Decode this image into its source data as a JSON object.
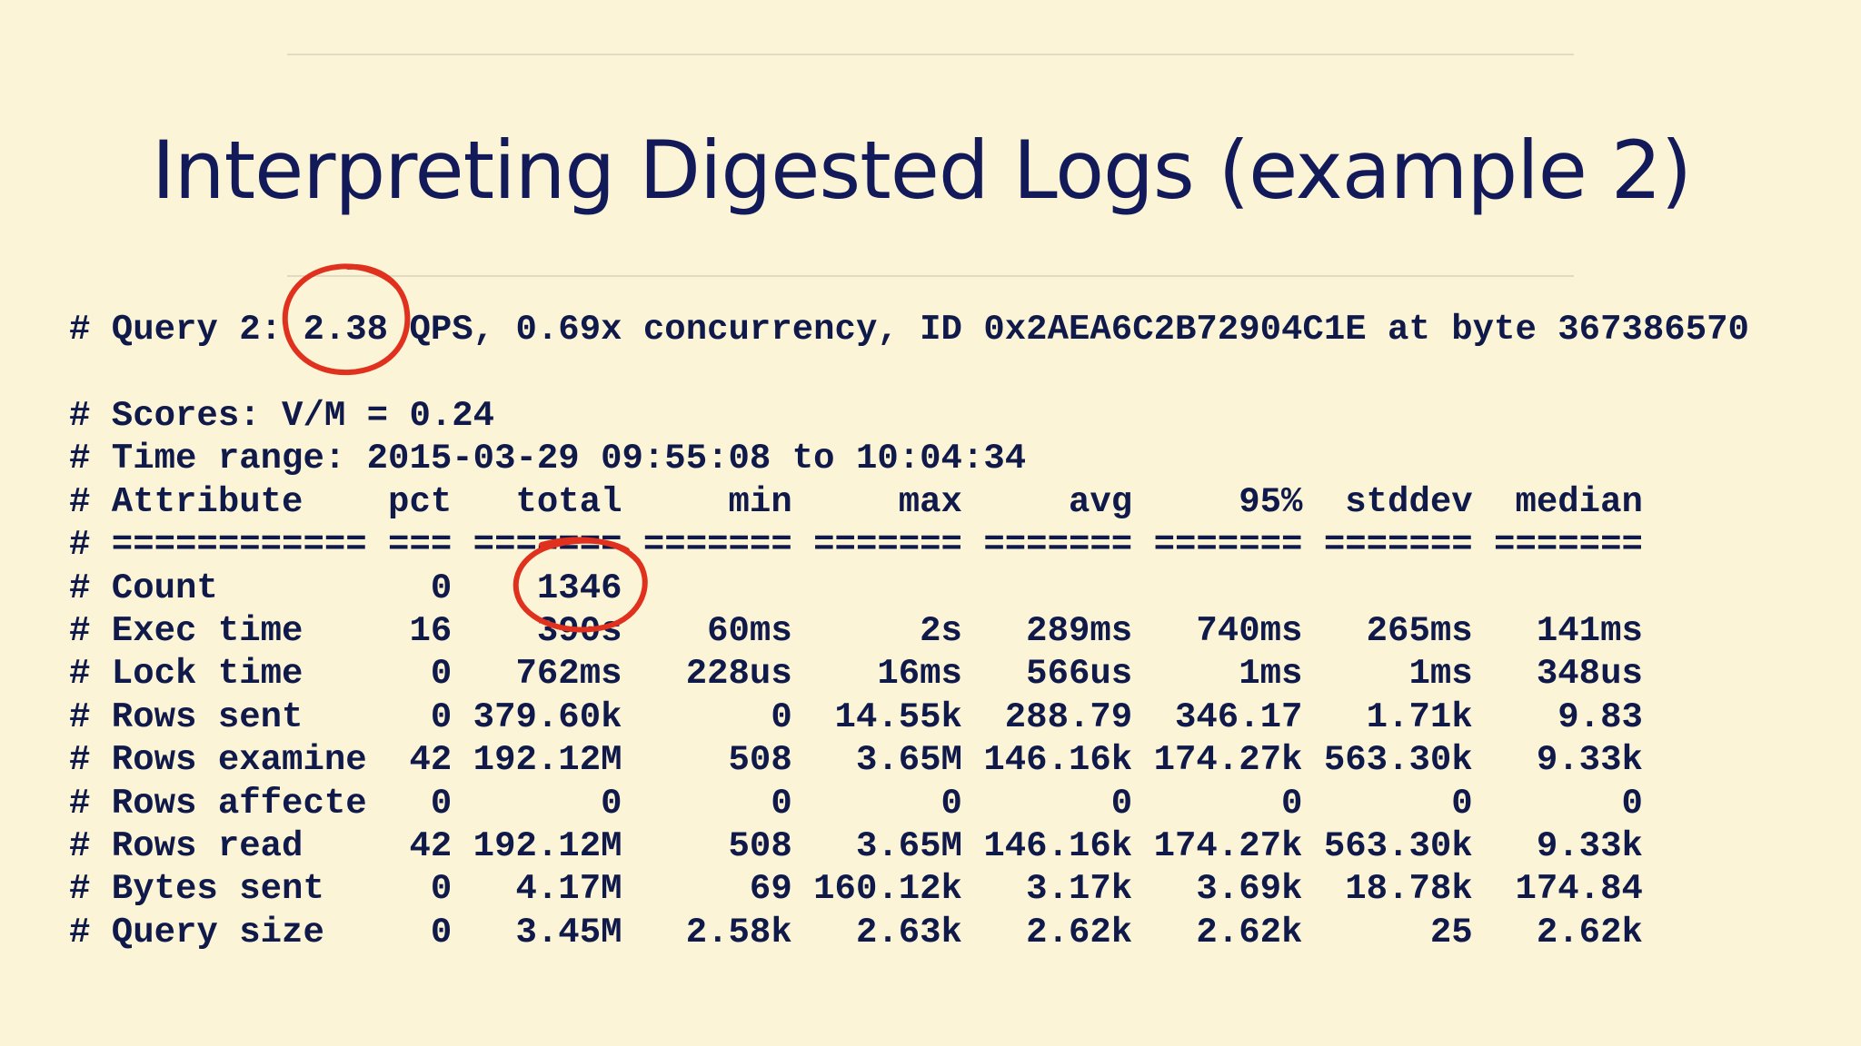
{
  "title": "Interpreting Digested Logs (example 2)",
  "query_line": "# Query 2: 2.38 QPS, 0.69x concurrency, ID 0x2AEA6C2B72904C1E at byte 367386570",
  "scores_line": "# Scores: V/M = 0.24",
  "time_range_line": "# Time range: 2015-03-29 09:55:08 to 10:04:34",
  "header_line": "# Attribute    pct   total     min     max     avg     95%  stddev  median",
  "separator_line": "# ============ === ======= ======= ======= ======= ======= ======= =======",
  "rows": [
    "# Count          0    1346",
    "# Exec time     16    390s    60ms      2s   289ms   740ms   265ms   141ms",
    "# Lock time      0   762ms   228us    16ms   566us     1ms     1ms   348us",
    "# Rows sent      0 379.60k       0  14.55k  288.79  346.17   1.71k    9.83",
    "# Rows examine  42 192.12M     508   3.65M 146.16k 174.27k 563.30k   9.33k",
    "# Rows affecte   0       0       0       0       0       0       0       0",
    "# Rows read     42 192.12M     508   3.65M 146.16k 174.27k 563.30k   9.33k",
    "# Bytes sent     0   4.17M      69 160.12k   3.17k   3.69k  18.78k  174.84",
    "# Query size     0   3.45M   2.58k   2.63k   2.62k   2.62k      25   2.62k"
  ],
  "highlight_color": "#e0301e"
}
